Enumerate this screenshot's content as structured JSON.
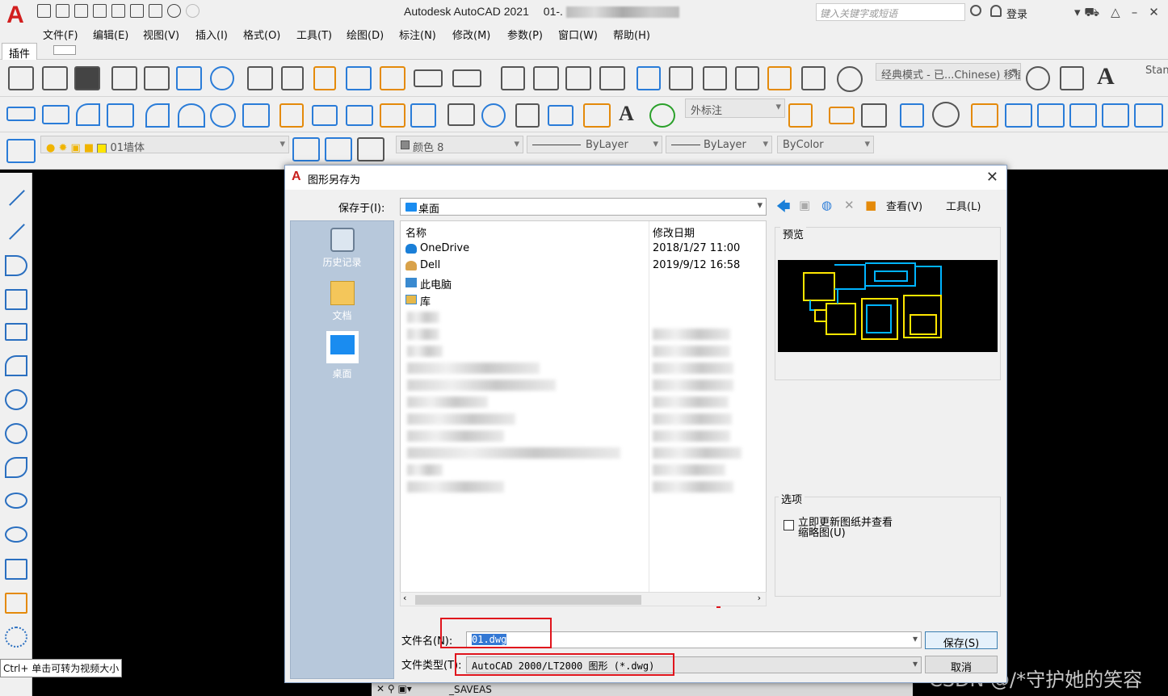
{
  "app": {
    "title": "Autodesk AutoCAD 2021",
    "file_title": "01-.",
    "search_placeholder": "键入关键字或短语",
    "login": "登录"
  },
  "menu": [
    "文件(F)",
    "编辑(E)",
    "视图(V)",
    "插入(I)",
    "格式(O)",
    "工具(T)",
    "绘图(D)",
    "标注(N)",
    "修改(M)",
    "参数(P)",
    "窗口(W)",
    "帮助(H)"
  ],
  "ribbon": {
    "tab": "插件"
  },
  "toolbars": {
    "workspace": "经典模式 - 已...Chinese) 移植",
    "stand": "Stand",
    "dim_style": "外标注",
    "layer": "01墙体",
    "color": "颜色 8",
    "linetype": "ByLayer",
    "lineweight": "ByLayer",
    "plotstyle": "ByColor"
  },
  "dialog": {
    "title": "图形另存为",
    "save_in_label": "保存于(I):",
    "save_in_value": "桌面",
    "view_label": "查看(V)",
    "tools_label": "工具(L)",
    "places": [
      {
        "label": "历史记录"
      },
      {
        "label": "文档"
      },
      {
        "label": "桌面"
      }
    ],
    "columns": {
      "name": "名称",
      "date": "修改日期"
    },
    "files": [
      {
        "name": "OneDrive",
        "date": "2018/1/27 11:00"
      },
      {
        "name": "Dell",
        "date": "2019/9/12 16:58"
      },
      {
        "name": "此电脑",
        "date": ""
      },
      {
        "name": "库",
        "date": ""
      }
    ],
    "preview_label": "预览",
    "options_label": "选项",
    "option_checkbox": "立即更新图纸并查看缩略图(U)",
    "filename_label": "文件名(N):",
    "filename_value": "01.dwg",
    "filetype_label": "文件类型(T):",
    "filetype_value": "AutoCAD 2000/LT2000 图形 (*.dwg)",
    "save_button": "保存(S)",
    "cancel_button": "取消"
  },
  "tooltip": "Ctrl+ 单击可转为视频大小",
  "command_line": "_SAVEAS",
  "watermark": "CSDN @/*守护她的笑容",
  "colors": {
    "accent": "#2a7cd8",
    "highlight_red": "#e0141c",
    "cad_blue": "#00b4ff",
    "cad_yellow": "#ffe600"
  }
}
